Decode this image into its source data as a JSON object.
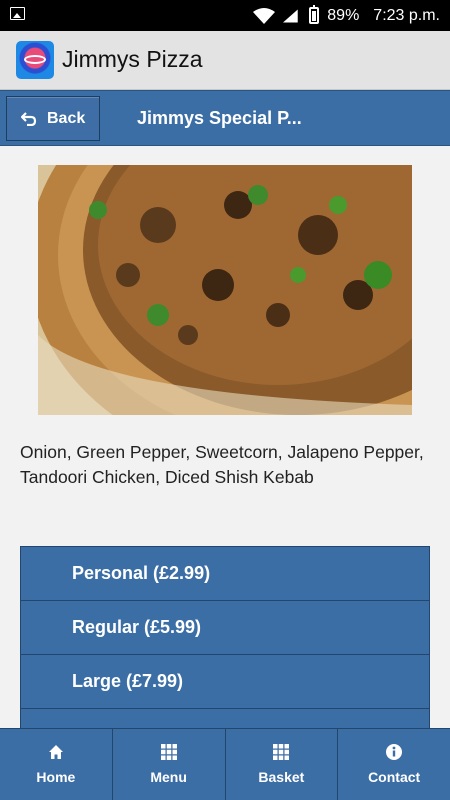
{
  "status_bar": {
    "battery": "89%",
    "time": "7:23 p.m.",
    "icons": [
      "image-icon",
      "wifi-icon",
      "signal-icon",
      "battery-icon"
    ]
  },
  "app_bar": {
    "title": "Jimmys Pizza",
    "logo_icon": "jimmys-pizza-logo"
  },
  "header": {
    "back_label": "Back",
    "back_icon": "back-arrow-icon",
    "title": "Jimmys Special P..."
  },
  "product": {
    "image": "pizza-photo",
    "description": "Onion, Green Pepper, Sweetcorn, Jalapeno Pepper, Tandoori Chicken, Diced Shish Kebab"
  },
  "options": [
    {
      "label": "Personal (£2.99)"
    },
    {
      "label": "Regular (£5.99)"
    },
    {
      "label": "Large (£7.99)"
    }
  ],
  "bottom_nav": [
    {
      "label": "Home",
      "icon": "home-icon"
    },
    {
      "label": "Menu",
      "icon": "grid-icon"
    },
    {
      "label": "Basket",
      "icon": "grid-icon"
    },
    {
      "label": "Contact",
      "icon": "info-icon"
    }
  ],
  "colors": {
    "primary": "#3c6ea6",
    "border": "#22466e",
    "background": "#f2f2f2",
    "app_bar": "#e3e3e3"
  }
}
